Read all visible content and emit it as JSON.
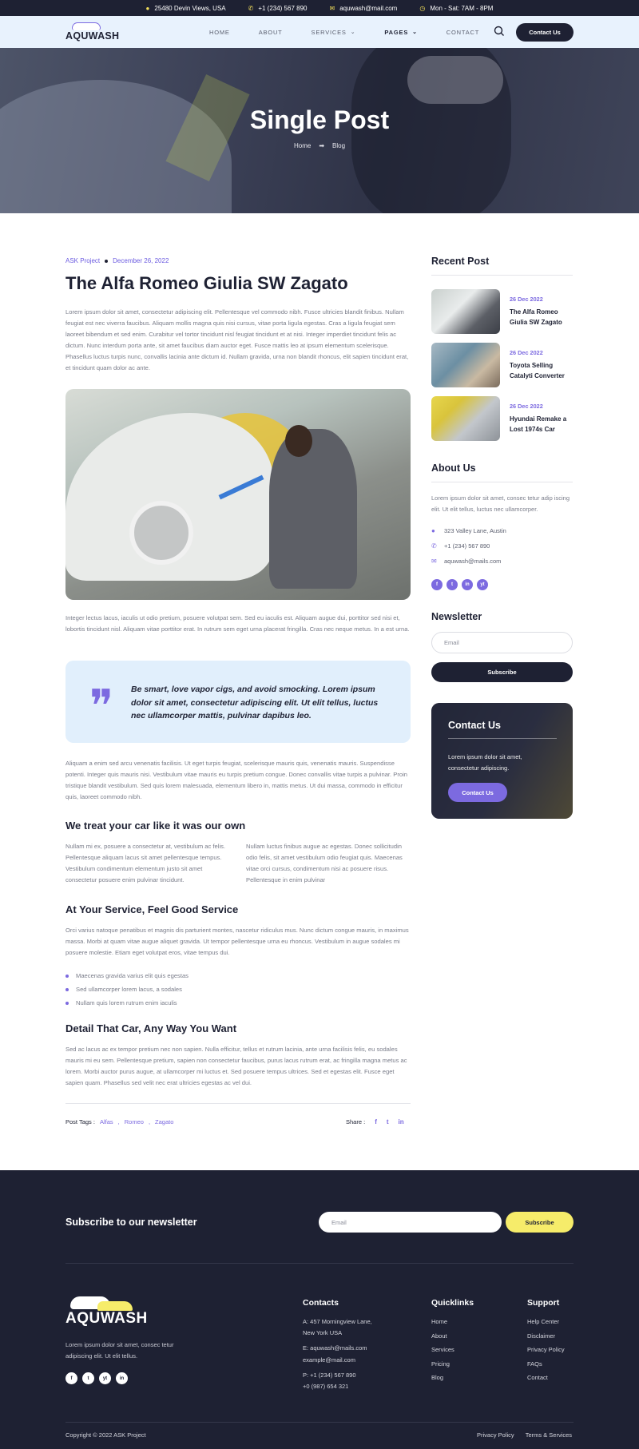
{
  "topbar": {
    "address": "25480 Devin Views, USA",
    "phone": "+1 (234) 567 890",
    "email": "aquwash@mail.com",
    "hours": "Mon - Sat: 7AM - 8PM"
  },
  "header": {
    "logo": "AQUWASH",
    "nav": [
      "HOME",
      "ABOUT",
      "SERVICES",
      "PAGES",
      "CONTACT"
    ],
    "cta": "Contact Us"
  },
  "hero": {
    "title": "Single Post",
    "breadcrumb_home": "Home",
    "breadcrumb_sep": "➡",
    "breadcrumb_current": "Blog"
  },
  "post": {
    "category": "ASK Project",
    "date": "December 26, 2022",
    "title": "The Alfa Romeo Giulia SW Zagato",
    "intro": "Lorem ipsum dolor sit amet, consectetur adipiscing elit. Pellentesque vel commodo nibh. Fusce ultricies blandit finibus. Nullam feugiat est nec viverra faucibus. Aliquam mollis magna quis nisi cursus, vitae porta ligula egestas. Cras a ligula feugiat sem laoreet bibendum et sed enim. Curabitur vel tortor tincidunt nisl feugiat tincidunt et at nisi. Integer imperdiet tincidunt felis ac dictum. Nunc interdum porta ante, sit amet faucibus diam auctor eget. Fusce mattis leo at ipsum elementum scelerisque. Phasellus luctus turpis nunc, convallis lacinia ante dictum id. Nullam gravida, urna non blandit rhoncus, elit sapien tincidunt erat, et tincidunt quam dolor ac ante.",
    "para2": "Integer lectus lacus, iaculis ut odio pretium, posuere volutpat sem. Sed eu iaculis est. Aliquam augue dui, porttitor sed nisi et, lobortis tincidunt nisl. Aliquam vitae porttitor erat. In rutrum sem eget urna placerat fringilla. Cras nec neque metus. In a est urna.",
    "quote_mark": "❞",
    "quote": "Be smart, love vapor cigs, and avoid smocking. Lorem ipsum dolor sit amet, consectetur adipiscing elit. Ut elit tellus, luctus nec ullamcorper mattis, pulvinar dapibus leo.",
    "para3": "Aliquam a enim sed arcu venenatis facilisis. Ut eget turpis feugiat, scelerisque mauris quis, venenatis mauris. Suspendisse potenti. Integer quis mauris nisi. Vestibulum vitae mauris eu turpis pretium congue. Donec convallis vitae turpis a pulvinar. Proin tristique blandit vestibulum. Sed quis lorem malesuada, elementum libero in, mattis metus. Ut dui massa, commodo in efficitur quis, laoreet commodo nibh.",
    "h2_1": "We treat your car like it was our own",
    "col1": "Nullam mi ex, posuere a consectetur at, vestibulum ac felis. Pellentesque aliquam lacus sit amet pellentesque tempus. Vestibulum condimentum elementum justo sit amet consectetur posuere enim pulvinar tincidunt.",
    "col2": "Nullam luctus finibus augue ac egestas. Donec sollicitudin odio felis, sit amet vestibulum odio feugiat quis. Maecenas vitae orci cursus, condimentum nisi ac posuere risus. Pellentesque in enim pulvinar",
    "h2_2": "At Your Service, Feel Good Service",
    "para4": "Orci varius natoque penatibus et magnis dis parturient montes, nascetur ridiculus mus. Nunc dictum congue mauris, in maximus massa. Morbi at quam vitae augue aliquet gravida. Ut tempor pellentesque urna eu rhoncus. Vestibulum in augue sodales mi posuere molestie. Etiam eget volutpat eros, vitae tempus dui.",
    "list": [
      "Maecenas gravida varius elit quis egestas",
      "Sed ullamcorper lorem lacus, a sodales",
      "Nullam quis lorem rutrum enim iaculis"
    ],
    "h2_3": "Detail That Car, Any Way You Want",
    "para5": "Sed ac lacus ac ex tempor pretium nec non sapien. Nulla efficitur, tellus et rutrum lacinia, ante urna facilisis felis, eu sodales mauris mi eu sem. Pellentesque pretium, sapien non consectetur faucibus, purus lacus rutrum erat, ac fringilla magna metus ac lorem. Morbi auctor purus augue, at ullamcorper mi luctus et. Sed posuere tempus ultrices. Sed et egestas elit. Fusce eget sapien quam. Phasellus sed velit nec erat ultricies egestas ac vel dui.",
    "tags_label": "Post Tags :",
    "tags": [
      "Alfas",
      "Romeo",
      "Zagato"
    ],
    "share_label": "Share :",
    "share": [
      "f",
      "t",
      "in"
    ]
  },
  "sidebar": {
    "recent_title": "Recent Post",
    "recent": [
      {
        "date": "26 Dec 2022",
        "title": "The Alfa Romeo Giulia SW Zagato"
      },
      {
        "date": "26 Dec 2022",
        "title": "Toyota Selling Catalyti Converter"
      },
      {
        "date": "26 Dec 2022",
        "title": "Hyundai Remake a Lost 1974s Car"
      }
    ],
    "about_title": "About Us",
    "about_text": "Lorem ipsum dolor sit amet, consec tetur adip iscing elit. Ut elit tellus, luctus nec ullamcorper.",
    "address": "323 Valley Lane, Austin",
    "phone": "+1 (234) 567 890",
    "email": "aquwash@mails.com",
    "socials": [
      "f",
      "t",
      "in",
      "yt"
    ],
    "newsletter_title": "Newsletter",
    "newsletter_placeholder": "Email",
    "subscribe": "Subscribe",
    "cta_title": "Contact Us",
    "cta_text": "Lorem ipsum dolor sit amet, consectetur adipiscing.",
    "cta_button": "Contact Us"
  },
  "footer": {
    "newsletter_title": "Subscribe to our newsletter",
    "email_placeholder": "Email",
    "subscribe": "Subscribe",
    "logo": "AQUWASH",
    "about": "Lorem ipsum dolor sit amet, consec tetur adipiscing elit. Ut elit tellus.",
    "socials": [
      "f",
      "t",
      "yt",
      "in"
    ],
    "contacts_title": "Contacts",
    "contact_address1": "A: 457 Morningview Lane,",
    "contact_address2": "New York USA",
    "contact_email1": "E: aquwash@mails.com",
    "contact_email2": "example@mail.com",
    "contact_phone1": "P: +1 (234) 567 890",
    "contact_phone2": "+0 (987) 654 321",
    "quicklinks_title": "Quicklinks",
    "quicklinks": [
      "Home",
      "About",
      "Services",
      "Pricing",
      "Blog"
    ],
    "support_title": "Support",
    "support": [
      "Help Center",
      "Disclaimer",
      "Privacy Policy",
      "FAQs",
      "Contact"
    ],
    "copyright": "Copyright © 2022 ASK Project",
    "legal": [
      "Privacy Policy",
      "Terms & Services"
    ]
  },
  "colors": {
    "accent": "#7c6ae0",
    "dark": "#1e2133",
    "yellow": "#f6ec6a",
    "light_blue": "#e1effc"
  }
}
